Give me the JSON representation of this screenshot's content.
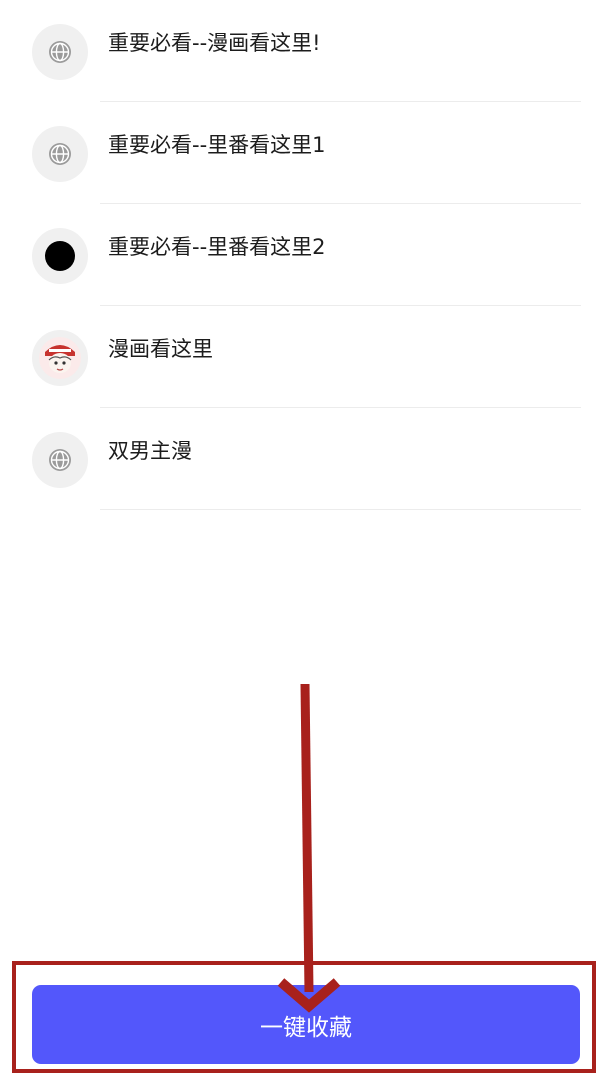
{
  "list": {
    "items": [
      {
        "title": "重要必看--漫画看这里!",
        "icon": "globe-icon"
      },
      {
        "title": "重要必看--里番看这里1",
        "icon": "globe-icon"
      },
      {
        "title": "重要必看--里番看这里2",
        "icon": "black-dot-icon"
      },
      {
        "title": "漫画看这里",
        "icon": "manga-avatar-icon"
      },
      {
        "title": "双男主漫",
        "icon": "globe-icon"
      }
    ]
  },
  "footer": {
    "collect_label": "一键收藏"
  },
  "colors": {
    "button": "#5357fb",
    "annotation": "#a8211c",
    "icon_bg": "#f0f0f0"
  }
}
